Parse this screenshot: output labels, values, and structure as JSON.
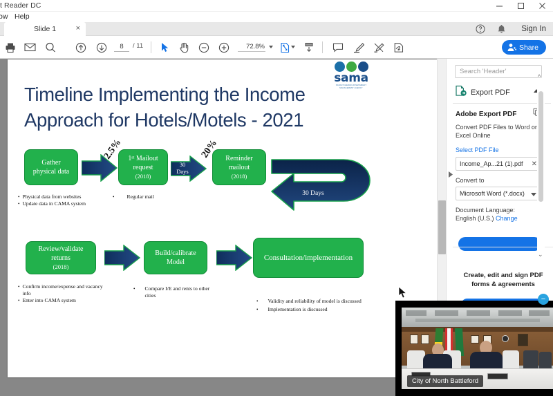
{
  "window": {
    "title": "t Reader DC",
    "controls": {
      "minimize": "minimize-icon",
      "maximize": "maximize-icon",
      "close": "close-icon"
    }
  },
  "menubar": {
    "items": [
      "ow",
      "Help"
    ]
  },
  "tabs": {
    "items": [
      {
        "label": "Slide 1",
        "close": "×"
      }
    ]
  },
  "toolbar": {
    "print_icon": "print-icon",
    "email_icon": "email-icon",
    "search_icon": "search-icon",
    "prev_page_icon": "arrow-up-circle-icon",
    "next_page_icon": "arrow-down-circle-icon",
    "page_current": "8",
    "page_total": "/ 11",
    "select_icon": "cursor-select-icon",
    "hand_icon": "hand-tool-icon",
    "zoom_out_icon": "zoom-out-icon",
    "zoom_in_icon": "zoom-in-icon",
    "zoom_level": "72.8%",
    "fit_page_icon": "fit-page-icon",
    "scroll_mode_icon": "page-scroll-icon",
    "comment_icon": "comment-icon",
    "highlight_icon": "highlight-icon",
    "draw_icon": "draw-icon",
    "sign_icon": "sign-icon",
    "share_label": "Share",
    "share_icon": "share-person-icon",
    "share_color": "#1473e6"
  },
  "account": {
    "help_icon": "help-circle-icon",
    "bell_icon": "bell-icon",
    "signin_label": "Sign In"
  },
  "slide": {
    "logo": {
      "word": "sama",
      "subtitle_line1": "SASKATCHEWAN ASSESSMENT",
      "subtitle_line2": "MANAGEMENT AGENCY",
      "dot_colors": [
        "#1b6fa8",
        "#3faa43",
        "#1b4f8a"
      ]
    },
    "title": "Timeline Implementing the Income Approach for Hotels/Motels - 2021",
    "title_color": "#1f3864",
    "box_fill": "#22b14c",
    "arrow_fill": "#1f3864",
    "boxes": [
      {
        "name": "gather",
        "line1": "Gather",
        "line2": "physical data",
        "year": ""
      },
      {
        "name": "first-mailout",
        "line1": "1ˢᵗ Mailout",
        "line2": "request",
        "year": "(2018)"
      },
      {
        "name": "reminder-mailout",
        "line1": "Reminder",
        "line2": "mailout",
        "year": "(2018)"
      },
      {
        "name": "review-validate",
        "line1": "Review/validate",
        "line2": "returns",
        "year": "(2018)"
      },
      {
        "name": "build-calibrate",
        "line1": "Build/calibrate",
        "line2": "Model",
        "year": ""
      },
      {
        "name": "consultation",
        "line1": "Consultation/implementation",
        "line2": "",
        "year": ""
      }
    ],
    "percent_labels": [
      "2.5%",
      "20%"
    ],
    "arrow_labels": {
      "days30_a": "30\nDays",
      "days30_b": "30 Days"
    },
    "bullets": {
      "gather": [
        "Physical data from websites",
        "Update data in CAMA system"
      ],
      "first_mailout": [
        "Regular mail"
      ],
      "review": [
        "Confirm income/expense and vacancy info",
        "Enter into CAMA system"
      ],
      "build": [
        "Compare I/E and rents to other cities"
      ],
      "consultation": [
        "Validity and reliability of model is discussed",
        "Implementation is discussed"
      ]
    }
  },
  "rightpanel": {
    "search_placeholder": "Search 'Header'",
    "export_header": "Export PDF",
    "export_icon": "export-pdf-icon",
    "collapse_icon": "chevron-up-icon",
    "panel_collapse_icon": "chevron-right-icon",
    "card_title": "Adobe Export PDF",
    "card_icon": "copy-icon",
    "card_desc": "Convert PDF Files to Word or Excel Online",
    "select_file_label": "Select PDF File",
    "selected_file": "Income_Ap...21 (1).pdf",
    "clear_file_icon": "close-icon",
    "convert_to_label": "Convert to",
    "convert_to_value": "Microsoft Word (*.docx)",
    "doc_language_label": "Document Language:",
    "doc_language_value": "English (U.S.)",
    "doc_language_change": "Change",
    "promo_line1": "Create, edit and sign PDF",
    "promo_line2": "forms & agreements"
  },
  "video": {
    "caption": "City of North Battleford",
    "minimize_icon": "minimize-icon"
  }
}
